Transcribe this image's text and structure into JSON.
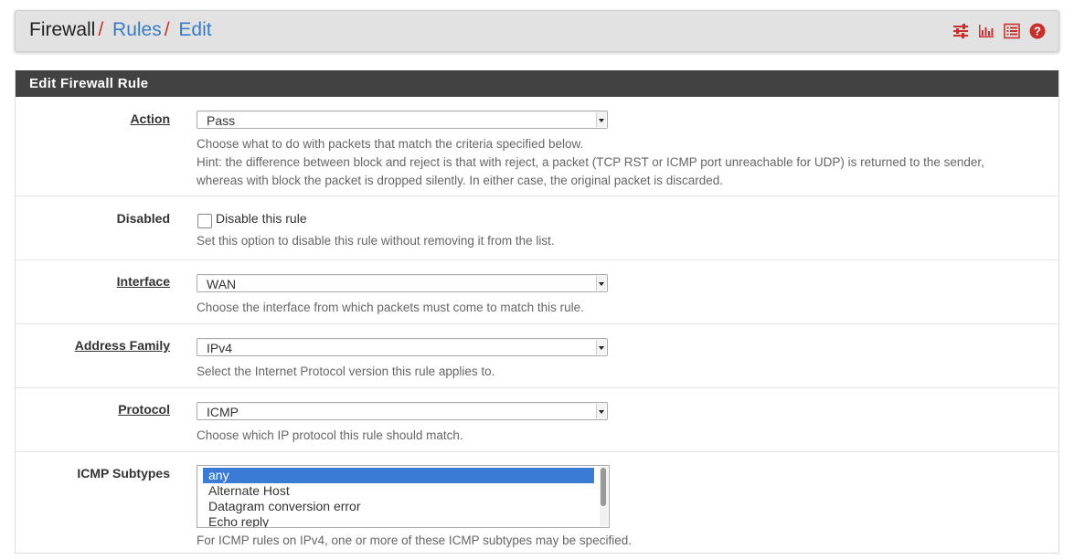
{
  "breadcrumb": {
    "items": [
      "Firewall",
      "Rules",
      "Edit"
    ],
    "separator": "/"
  },
  "header_icons": [
    "sliders-icon",
    "bar-chart-icon",
    "list-icon",
    "help-icon"
  ],
  "panel": {
    "title": "Edit Firewall Rule"
  },
  "action": {
    "label": "Action",
    "value": "Pass",
    "help": [
      "Choose what to do with packets that match the criteria specified below.",
      "Hint: the difference between block and reject is that with reject, a packet (TCP RST or ICMP port unreachable for UDP) is returned to the sender,",
      "whereas with block the packet is dropped silently. In either case, the original packet is discarded."
    ]
  },
  "disabled": {
    "label": "Disabled",
    "checkbox_label": "Disable this rule",
    "checked": false,
    "help": "Set this option to disable this rule without removing it from the list."
  },
  "interface": {
    "label": "Interface",
    "value": "WAN",
    "help": "Choose the interface from which packets must come to match this rule."
  },
  "address_family": {
    "label": "Address Family",
    "value": "IPv4",
    "help": "Select the Internet Protocol version this rule applies to."
  },
  "protocol": {
    "label": "Protocol",
    "value": "ICMP",
    "help": "Choose which IP protocol this rule should match."
  },
  "icmp_subtypes": {
    "label": "ICMP Subtypes",
    "options": [
      "any",
      "Alternate Host",
      "Datagram conversion error",
      "Echo reply"
    ],
    "selected": "any",
    "help": "For ICMP rules on IPv4, one or more of these ICMP subtypes may be specified."
  },
  "colors": {
    "accent": "#c9302c",
    "link": "#3a7bc8",
    "panel_header": "#424242",
    "selected": "#3a7bd5"
  }
}
